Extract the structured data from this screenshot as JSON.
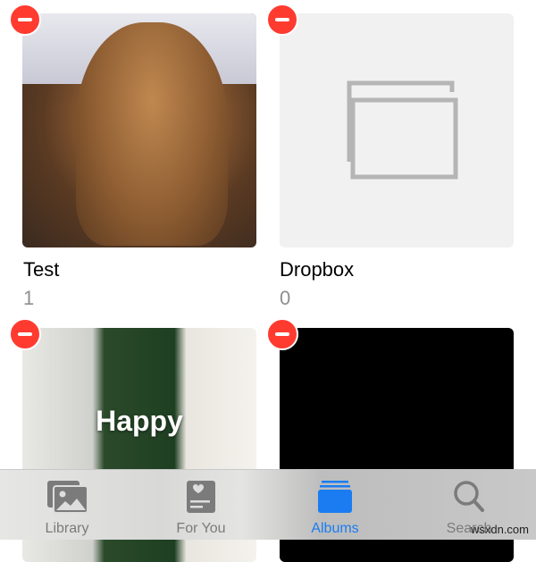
{
  "albums": [
    {
      "title": "Test",
      "count": "1"
    },
    {
      "title": "Dropbox",
      "count": "0"
    },
    {
      "photo_text": "Happy"
    },
    {}
  ],
  "tabs": [
    {
      "label": "Library",
      "icon": "photo-stack-icon"
    },
    {
      "label": "For You",
      "icon": "memories-icon"
    },
    {
      "label": "Albums",
      "icon": "albums-icon",
      "active": true
    },
    {
      "label": "Search",
      "icon": "search-icon"
    }
  ],
  "colors": {
    "accent": "#1a7cf0",
    "delete": "#ff3b30",
    "inactive": "#7b7b7b"
  },
  "watermark": "wsxdn.com"
}
